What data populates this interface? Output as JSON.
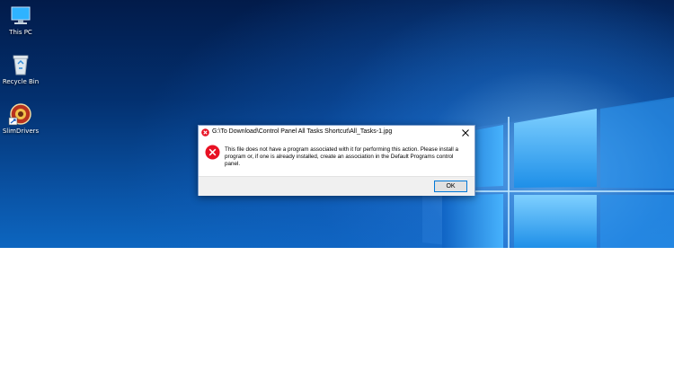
{
  "desktop": {
    "icons": [
      {
        "label": "This PC",
        "icon": "computer-icon"
      },
      {
        "label": "Recycle Bin",
        "icon": "recycle-bin-icon"
      },
      {
        "label": "SlimDrivers",
        "icon": "slimdrivers-icon"
      }
    ]
  },
  "dialog": {
    "title": "G:\\To Download\\Control Panel All Tasks Shortcut\\All_Tasks-1.jpg",
    "message": "This file does not have a program associated with it for performing this action. Please install a program or, if one is already installed, create an association in the Default Programs control panel.",
    "ok_label": "OK",
    "error_icon": "error-icon",
    "close_icon": "close-icon"
  },
  "colors": {
    "error_red": "#e81123",
    "button_focus_border": "#0078d7",
    "footer_bg": "#f0f0f0"
  }
}
